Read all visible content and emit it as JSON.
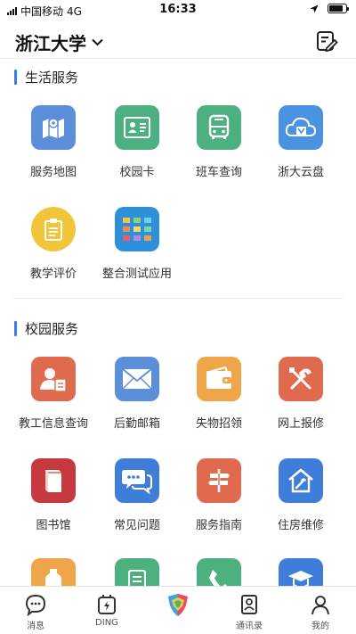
{
  "status_bar": {
    "carrier": "中国移动",
    "network": "4G",
    "time": "16:33",
    "battery_level": 0.85
  },
  "header": {
    "title": "浙江大学"
  },
  "sections": {
    "life": {
      "title": "生活服务",
      "items": [
        {
          "label": "服务地图",
          "icon": "map-icon",
          "color": "#5b8fd9"
        },
        {
          "label": "校园卡",
          "icon": "id-card-icon",
          "color": "#4cb07f"
        },
        {
          "label": "班车查询",
          "icon": "bus-icon",
          "color": "#4cb07f"
        },
        {
          "label": "浙大云盘",
          "icon": "cloud-drive-icon",
          "color": "#4a93e0"
        },
        {
          "label": "教学评价",
          "icon": "clipboard-icon",
          "color": "#f0c53a"
        },
        {
          "label": "整合测试应用",
          "icon": "app-grid-icon",
          "color": "#2f8fd8"
        }
      ]
    },
    "campus": {
      "title": "校园服务",
      "items": [
        {
          "label": "教工信息查询",
          "icon": "staff-info-icon",
          "color": "#e06a4e"
        },
        {
          "label": "后勤邮箱",
          "icon": "mail-icon",
          "color": "#5b8fd9"
        },
        {
          "label": "失物招领",
          "icon": "wallet-icon",
          "color": "#efa54a"
        },
        {
          "label": "网上报修",
          "icon": "tools-icon",
          "color": "#e06a4e"
        },
        {
          "label": "图书馆",
          "icon": "book-icon",
          "color": "#c63a3f"
        },
        {
          "label": "常见问题",
          "icon": "chat-icon",
          "color": "#3f7ed8"
        },
        {
          "label": "服务指南",
          "icon": "signpost-icon",
          "color": "#e06a4e"
        },
        {
          "label": "住房维修",
          "icon": "house-repair-icon",
          "color": "#3f7ed8"
        }
      ]
    }
  },
  "partial_row_colors": [
    "#efa54a",
    "#4cb07f",
    "#4cb07f",
    "#3f7ed8"
  ],
  "tabs": [
    {
      "label": "消息",
      "icon": "message-icon"
    },
    {
      "label": "DING",
      "icon": "ding-icon"
    },
    {
      "label": "",
      "icon": "app-logo-icon"
    },
    {
      "label": "通讯录",
      "icon": "contacts-icon"
    },
    {
      "label": "我的",
      "icon": "profile-icon"
    }
  ]
}
